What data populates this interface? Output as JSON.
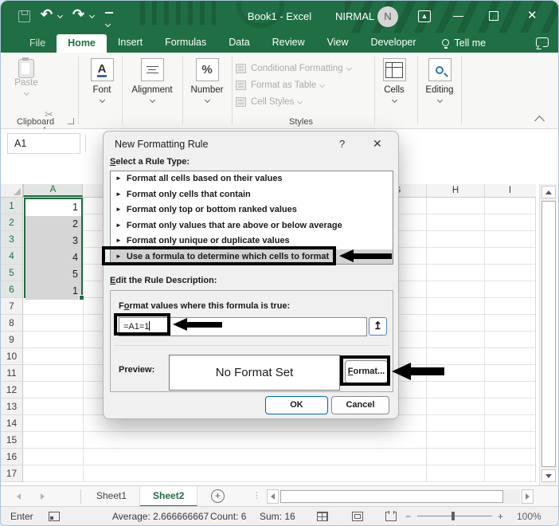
{
  "window": {
    "title": "Book1 - Excel",
    "account": "NIRMAL",
    "avatar_initial": "N"
  },
  "tabs": {
    "file_label": "File",
    "items": [
      "Home",
      "Insert",
      "Formulas",
      "Data",
      "Review",
      "View",
      "Developer"
    ],
    "active": "Home",
    "tell_me_label": "Tell me"
  },
  "ribbon": {
    "paste_label": "Paste",
    "clipboard_group_label": "Clipboard",
    "font_label": "Font",
    "font_symbol": "A",
    "alignment_label": "Alignment",
    "number_label": "Number",
    "number_symbol": "%",
    "styles_items": [
      "Conditional Formatting",
      "Format as Table",
      "Cell Styles"
    ],
    "styles_group_label": "Styles",
    "cells_label": "Cells",
    "editing_label": "Editing"
  },
  "formula_bar": {
    "name_box_value": "A1"
  },
  "dialog": {
    "title": "New Formatting Rule",
    "help_glyph": "?",
    "close_glyph": "✕",
    "select_rule_label": {
      "text": "Select a Rule Type:",
      "accel": 0
    },
    "rule_marker": "►",
    "rule_types": [
      "Format all cells based on their values",
      "Format only cells that contain",
      "Format only top or bottom ranked values",
      "Format only values that are above or below average",
      "Format only unique or duplicate values",
      "Use a formula to determine which cells to format"
    ],
    "selected_rule_index": 5,
    "edit_desc_label": {
      "text": "Edit the Rule Description:",
      "accel": 0
    },
    "formula_label": {
      "text": "Format values where this formula is true:",
      "accel": 1
    },
    "formula_value": "=A1=1",
    "collapse_glyph": "↥",
    "preview_label": "Preview:",
    "preview_value": "No Format Set",
    "format_button": {
      "text": "Format...",
      "accel": 0
    },
    "ok_label": "OK",
    "cancel_label": "Cancel"
  },
  "grid": {
    "left_column": "A",
    "right_columns": [
      "G",
      "H",
      "I"
    ],
    "row_count": 17,
    "column_a_values": [
      1,
      2,
      3,
      4,
      5,
      1
    ],
    "selected_row_count": 6
  },
  "sheet_bar": {
    "sheets": [
      "Sheet1",
      "Sheet2"
    ],
    "active": "Sheet2",
    "add_glyph": "+"
  },
  "status_bar": {
    "mode": "Enter",
    "average": "Average: 2.666666667",
    "count": "Count: 6",
    "sum": "Sum: 16",
    "zoom_minus": "−",
    "zoom_plus": "+",
    "zoom_level": "100%"
  },
  "colors": {
    "excel_green": "#1f6e44",
    "selection_fill": "#d6d6d6",
    "annotation_black": "#000000",
    "ok_border_blue": "#0067c0",
    "disabled_text": "#ababab"
  }
}
